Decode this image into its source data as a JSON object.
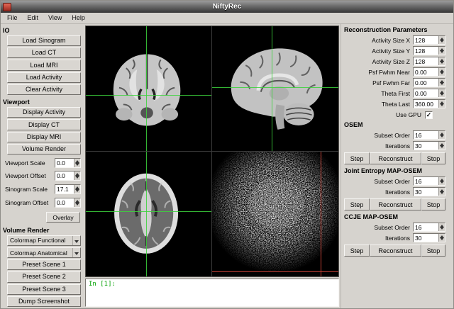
{
  "window": {
    "title": "NiftyRec"
  },
  "menubar": {
    "items": [
      "File",
      "Edit",
      "View",
      "Help"
    ]
  },
  "left_panel": {
    "io": {
      "title": "IO",
      "buttons": [
        "Load Sinogram",
        "Load CT",
        "Load MRI",
        "Load Activity",
        "Clear Activity"
      ]
    },
    "viewport": {
      "title": "Viewport",
      "buttons": [
        "Display Activity",
        "Display CT",
        "Display MRI",
        "Volume Render"
      ],
      "fields": [
        {
          "label": "Viewport Scale",
          "value": "0.0"
        },
        {
          "label": "Viewport Offset",
          "value": "0.0"
        },
        {
          "label": "Sinogram Scale",
          "value": "17.1"
        },
        {
          "label": "Sinogram Offset",
          "value": "0.0"
        }
      ],
      "overlay_button": "Overlay"
    },
    "volume_render": {
      "title": "Volume Render",
      "comboboxes": [
        "Colormap Functional",
        "Colormap Anatomical"
      ],
      "buttons": [
        "Preset Scene 1",
        "Preset Scene 2",
        "Preset Scene 3",
        "Dump Screenshot"
      ]
    }
  },
  "viewer": {
    "views": [
      "coronal",
      "sagittal",
      "axial",
      "sinogram"
    ],
    "crosshair_color": "#3cd23c",
    "sinogram_crosshair_color": "#d7463a"
  },
  "console": {
    "prompt": "In [1]:"
  },
  "right_panel": {
    "reconstruction": {
      "title": "Reconstruction Parameters",
      "fields": [
        {
          "label": "Activity Size X",
          "value": "128"
        },
        {
          "label": "Activity Size Y",
          "value": "128"
        },
        {
          "label": "Activity Size Z",
          "value": "128"
        },
        {
          "label": "Psf Fwhm Near",
          "value": "0.00"
        },
        {
          "label": "Psf Fwhm Far",
          "value": "0.00"
        },
        {
          "label": "Theta First",
          "value": "0.00"
        },
        {
          "label": "Theta Last",
          "value": "360.00"
        }
      ],
      "use_gpu": {
        "label": "Use GPU",
        "checked": true
      }
    },
    "sections": [
      {
        "title": "OSEM",
        "fields": [
          {
            "label": "Subset Order",
            "value": "16"
          },
          {
            "label": "Iterations",
            "value": "30"
          }
        ],
        "buttons": [
          "Step",
          "Reconstruct",
          "Stop"
        ]
      },
      {
        "title": "Joint Entropy MAP-OSEM",
        "fields": [
          {
            "label": "Subset Order",
            "value": "16"
          },
          {
            "label": "Iterations",
            "value": "30"
          }
        ],
        "buttons": [
          "Step",
          "Reconstruct",
          "Stop"
        ]
      },
      {
        "title": "CCJE MAP-OSEM",
        "fields": [
          {
            "label": "Subset Order",
            "value": "16"
          },
          {
            "label": "Iterations",
            "value": "30"
          }
        ],
        "buttons": [
          "Step",
          "Reconstruct",
          "Stop"
        ]
      }
    ]
  }
}
